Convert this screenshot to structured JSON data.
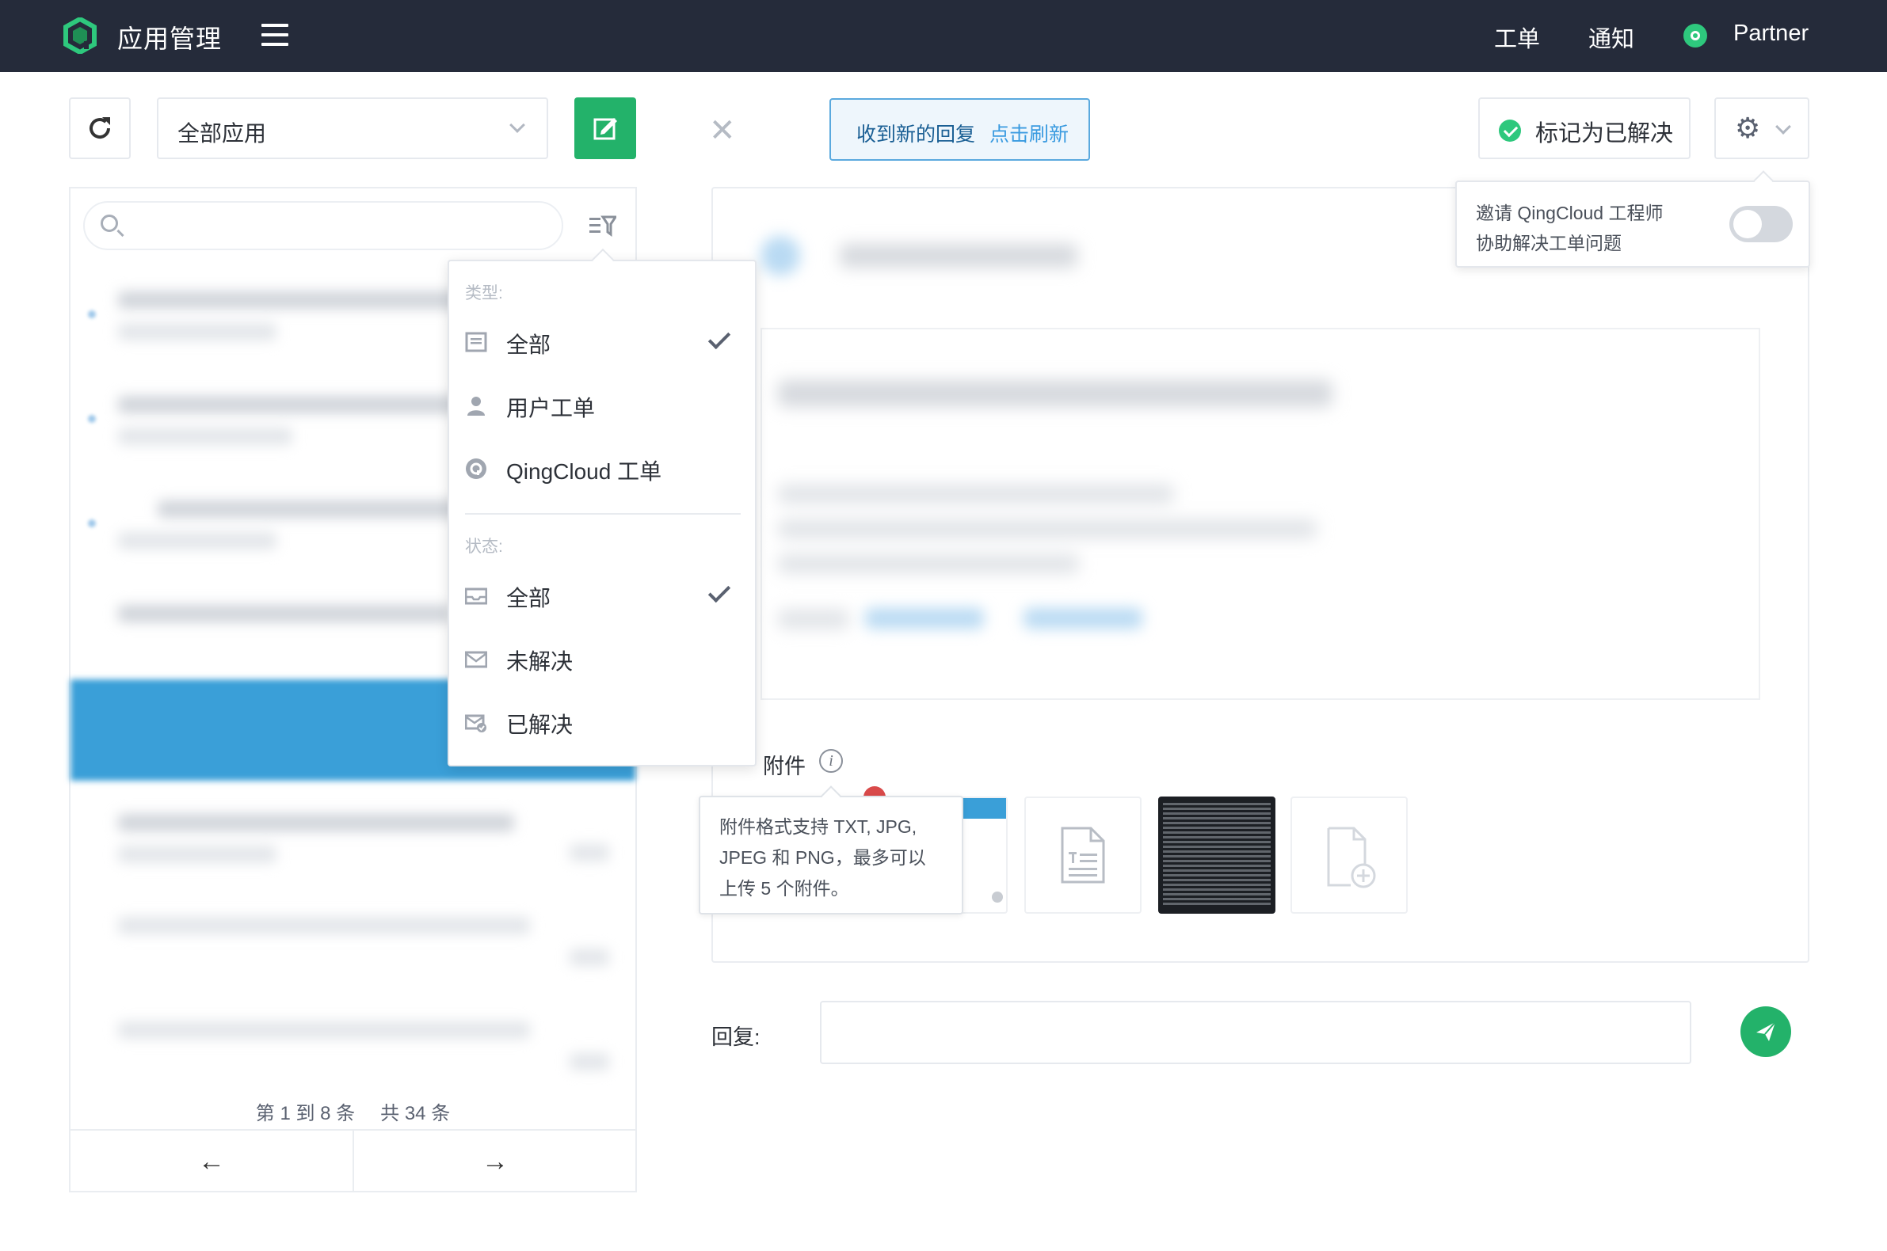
{
  "header": {
    "app_title": "应用管理",
    "nav": {
      "tickets": "工单",
      "notifications": "通知",
      "partner": "Partner"
    }
  },
  "toolbar": {
    "app_filter_value": "全部应用",
    "notice_text": "收到新的回复",
    "notice_link": "点击刷新",
    "resolve_label": "标记为已解决"
  },
  "invite_popover": {
    "line1": "邀请 QingCloud 工程师",
    "line2": "协助解决工单问题",
    "toggle_on": false
  },
  "filter_menu": {
    "type_heading": "类型:",
    "type_items": [
      {
        "label": "全部",
        "icon": "inbox-icon",
        "checked": true
      },
      {
        "label": "用户工单",
        "icon": "user-icon",
        "checked": false
      },
      {
        "label": "QingCloud 工单",
        "icon": "qingcloud-icon",
        "checked": false
      }
    ],
    "status_heading": "状态:",
    "status_items": [
      {
        "label": "全部",
        "icon": "mail-open-icon",
        "checked": true
      },
      {
        "label": "未解决",
        "icon": "mail-icon",
        "checked": false
      },
      {
        "label": "已解决",
        "icon": "mail-check-icon",
        "checked": false
      }
    ]
  },
  "pagination": {
    "range": "第 1 到 8 条",
    "total": "共 34 条"
  },
  "attachments": {
    "label": "附件",
    "tooltip": "附件格式支持 TXT, JPG, JPEG 和 PNG，最多可以上传 5 个附件。"
  },
  "reply": {
    "label": "回复:"
  },
  "colors": {
    "topbar": "#252b3a",
    "accent_green": "#23b26a",
    "notice_border": "#5aa9de",
    "selected_row": "#3a9fd8"
  }
}
